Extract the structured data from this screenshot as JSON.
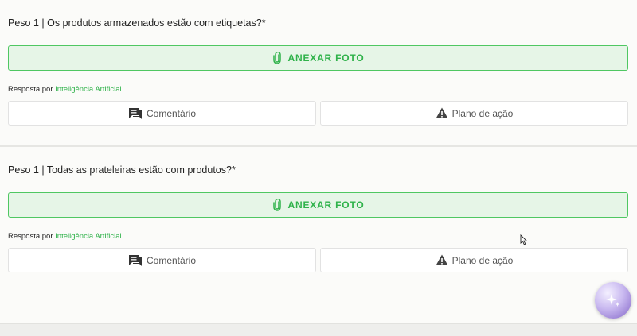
{
  "questions": [
    {
      "title": "Peso 1 | Os produtos armazenados estão com etiquetas?*",
      "attach_label": "ANEXAR FOTO",
      "ai_prefix": "Resposta por",
      "ai_link": "Inteligência Artificial",
      "comment_label": "Comentário",
      "plan_label": "Plano de ação"
    },
    {
      "title": "Peso 1 | Todas as prateleiras estão com produtos?*",
      "attach_label": "ANEXAR FOTO",
      "ai_prefix": "Resposta por",
      "ai_link": "Inteligência Artificial",
      "comment_label": "Comentário",
      "plan_label": "Plano de ação"
    }
  ],
  "icons": {
    "attach": "paperclip-icon",
    "comment": "comment-icon",
    "plan": "warning-icon",
    "assistant": "ai-sparkle-icon"
  },
  "colors": {
    "accent_green": "#2fb24a",
    "attach_bg": "#e6f5e7",
    "attach_border": "#4fc762"
  }
}
